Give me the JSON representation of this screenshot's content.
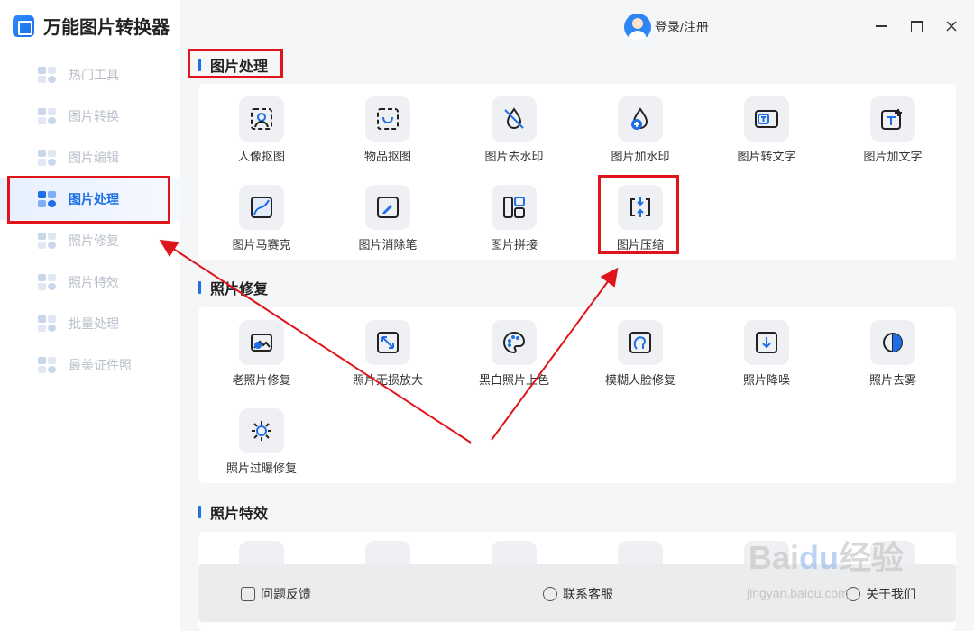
{
  "app": {
    "title": "万能图片转换器"
  },
  "sidebar": {
    "items": [
      {
        "label": "热门工具"
      },
      {
        "label": "图片转换"
      },
      {
        "label": "图片编辑"
      },
      {
        "label": "图片处理"
      },
      {
        "label": "照片修复"
      },
      {
        "label": "照片特效"
      },
      {
        "label": "批量处理"
      },
      {
        "label": "最美证件照"
      }
    ],
    "active_index": 3
  },
  "header": {
    "login_label": "登录/注册"
  },
  "sections": {
    "processing": {
      "title": "图片处理",
      "tools": [
        {
          "label": "人像抠图",
          "icon": "portrait-cutout-icon"
        },
        {
          "label": "物品抠图",
          "icon": "object-cutout-icon"
        },
        {
          "label": "图片去水印",
          "icon": "remove-watermark-icon"
        },
        {
          "label": "图片加水印",
          "icon": "add-watermark-icon"
        },
        {
          "label": "图片转文字",
          "icon": "image-to-text-icon"
        },
        {
          "label": "图片加文字",
          "icon": "add-text-icon"
        },
        {
          "label": "图片马赛克",
          "icon": "mosaic-icon"
        },
        {
          "label": "图片消除笔",
          "icon": "eraser-pen-icon"
        },
        {
          "label": "图片拼接",
          "icon": "collage-icon"
        },
        {
          "label": "图片压缩",
          "icon": "compress-icon"
        }
      ]
    },
    "repair": {
      "title": "照片修复",
      "tools": [
        {
          "label": "老照片修复",
          "icon": "old-photo-icon"
        },
        {
          "label": "照片无损放大",
          "icon": "upscale-icon"
        },
        {
          "label": "黑白照片上色",
          "icon": "palette-icon"
        },
        {
          "label": "模糊人脸修复",
          "icon": "face-restore-icon"
        },
        {
          "label": "照片降噪",
          "icon": "denoise-icon"
        },
        {
          "label": "照片去雾",
          "icon": "dehaze-icon"
        },
        {
          "label": "照片过曝修复",
          "icon": "overexposure-icon"
        }
      ]
    },
    "effects": {
      "title": "照片特效"
    }
  },
  "footer": {
    "feedback": "问题反馈",
    "support": "联系客服",
    "about": "关于我们"
  },
  "watermark": {
    "brand": "Bai",
    "brand_mid": "du",
    "brand_cn": "经验",
    "url": "jingyan.baidu.com"
  },
  "colors": {
    "accent": "#1e6fe6",
    "annotation": "#e0141b"
  }
}
